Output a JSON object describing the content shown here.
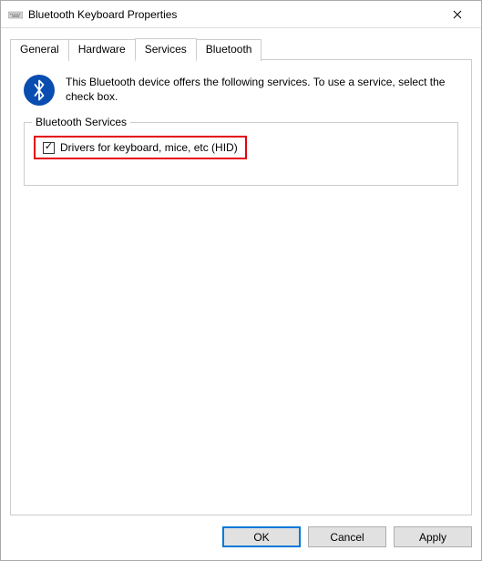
{
  "titlebar": {
    "title": "Bluetooth Keyboard Properties"
  },
  "tabs": {
    "general": "General",
    "hardware": "Hardware",
    "services": "Services",
    "bluetooth": "Bluetooth"
  },
  "intro": "This Bluetooth device offers the following services. To use a service, select the check box.",
  "group": {
    "label": "Bluetooth Services",
    "service0": "Drivers for keyboard, mice, etc (HID)"
  },
  "buttons": {
    "ok": "OK",
    "cancel": "Cancel",
    "apply": "Apply"
  }
}
